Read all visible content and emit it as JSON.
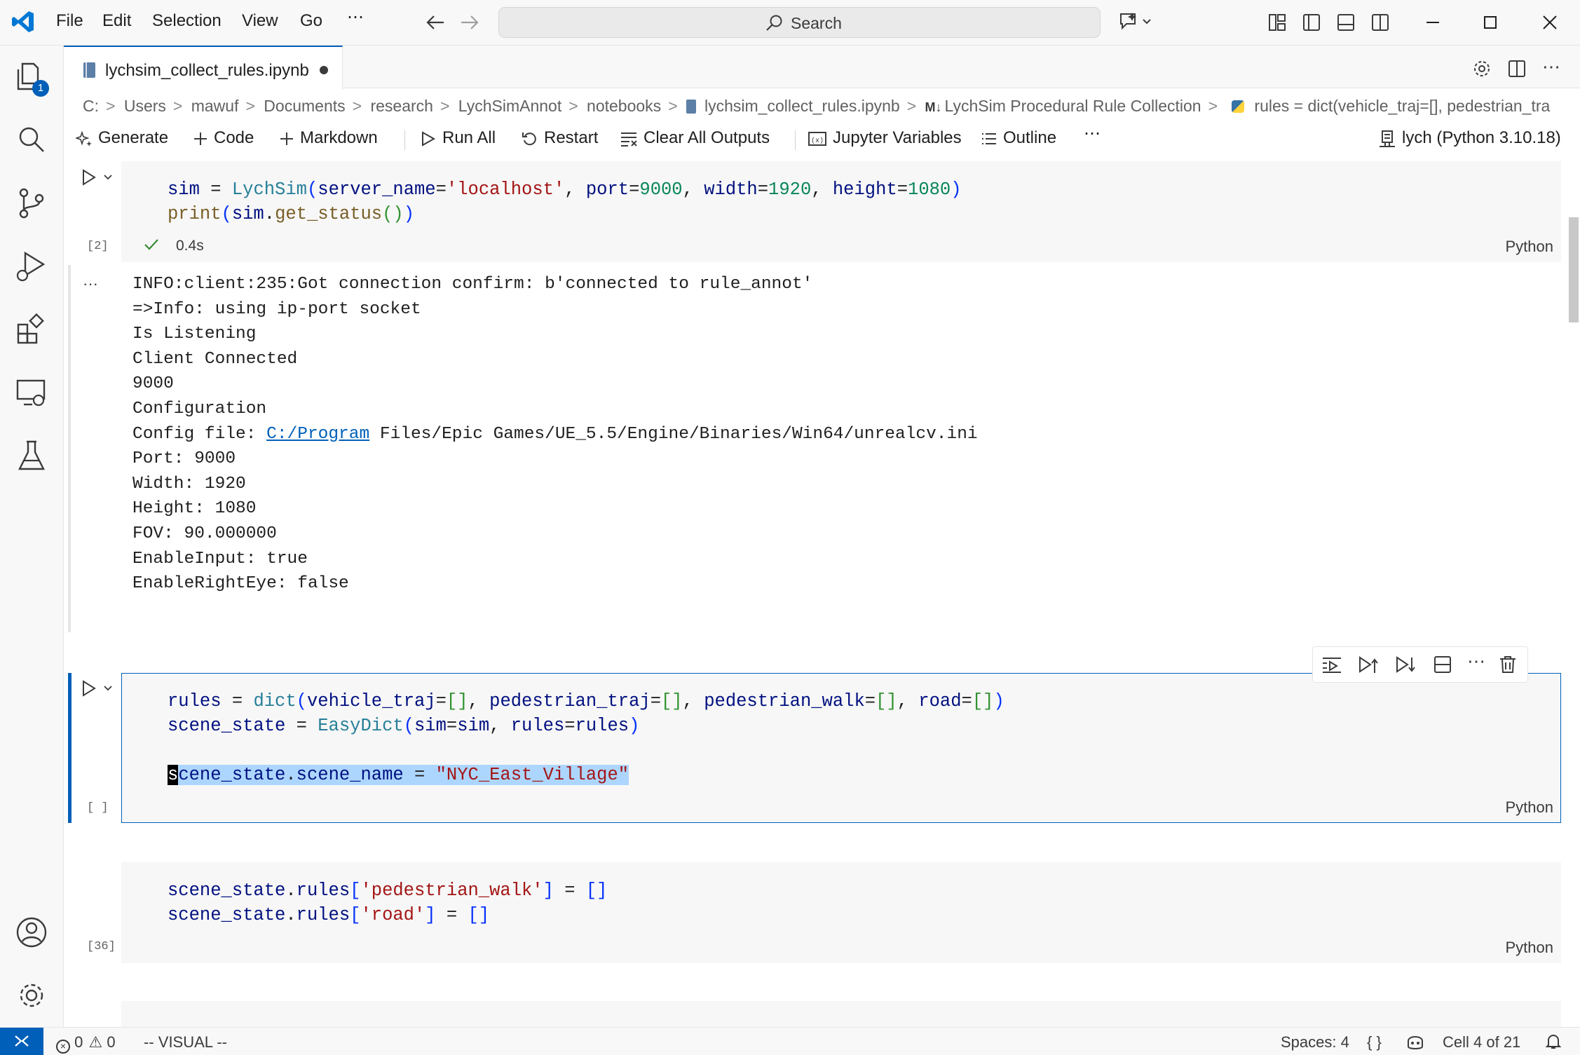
{
  "menu": [
    "File",
    "Edit",
    "Selection",
    "View",
    "Go",
    "⋯"
  ],
  "search": {
    "label": "Search"
  },
  "tab": {
    "title": "lychsim_collect_rules.ipynb"
  },
  "breadcrumb": [
    "C:",
    "Users",
    "mawuf",
    "Documents",
    "research",
    "LychSimAnnot",
    "notebooks",
    "lychsim_collect_rules.ipynb",
    "LychSim Procedural Rule Collection",
    "rules = dict(vehicle_traj=[], pedestrian_tra"
  ],
  "breadcrumb_prefix": {
    "markdown": "M↓"
  },
  "toolbar": {
    "generate": "Generate",
    "code": "Code",
    "markdown": "Markdown",
    "run_all": "Run All",
    "restart": "Restart",
    "clear": "Clear All Outputs",
    "variables": "Jupyter Variables",
    "outline": "Outline",
    "more": "⋯",
    "kernel": "lych (Python 3.10.18)"
  },
  "badges": {
    "explorer": "1"
  },
  "cells": [
    {
      "exec": "[2]",
      "time": "0.4s",
      "lang": "Python"
    },
    {
      "exec": "[ ]",
      "lang": "Python"
    },
    {
      "exec": "[36]",
      "lang": "Python"
    }
  ],
  "output": {
    "more": "···",
    "lines": [
      "INFO:client:235:Got connection confirm: b'connected to rule_annot'",
      "=>Info: using ip-port socket",
      "Is Listening",
      "Client Connected",
      "9000",
      "Configuration",
      "Port: 9000",
      "Width: 1920",
      "Height: 1080",
      "FOV: 90.000000",
      "EnableInput: true",
      "EnableRightEye: false"
    ],
    "config_prefix": "Config file: ",
    "config_link": "C:/Program",
    "config_rest": " Files/Epic Games/UE_5.5/Engine/Binaries/Win64/unrealcv.ini"
  },
  "status": {
    "errors": "0",
    "warnings": "0",
    "mode": "-- VISUAL --",
    "spaces": "Spaces: 4",
    "braces": "{ }",
    "cell": "Cell 4 of 21"
  }
}
